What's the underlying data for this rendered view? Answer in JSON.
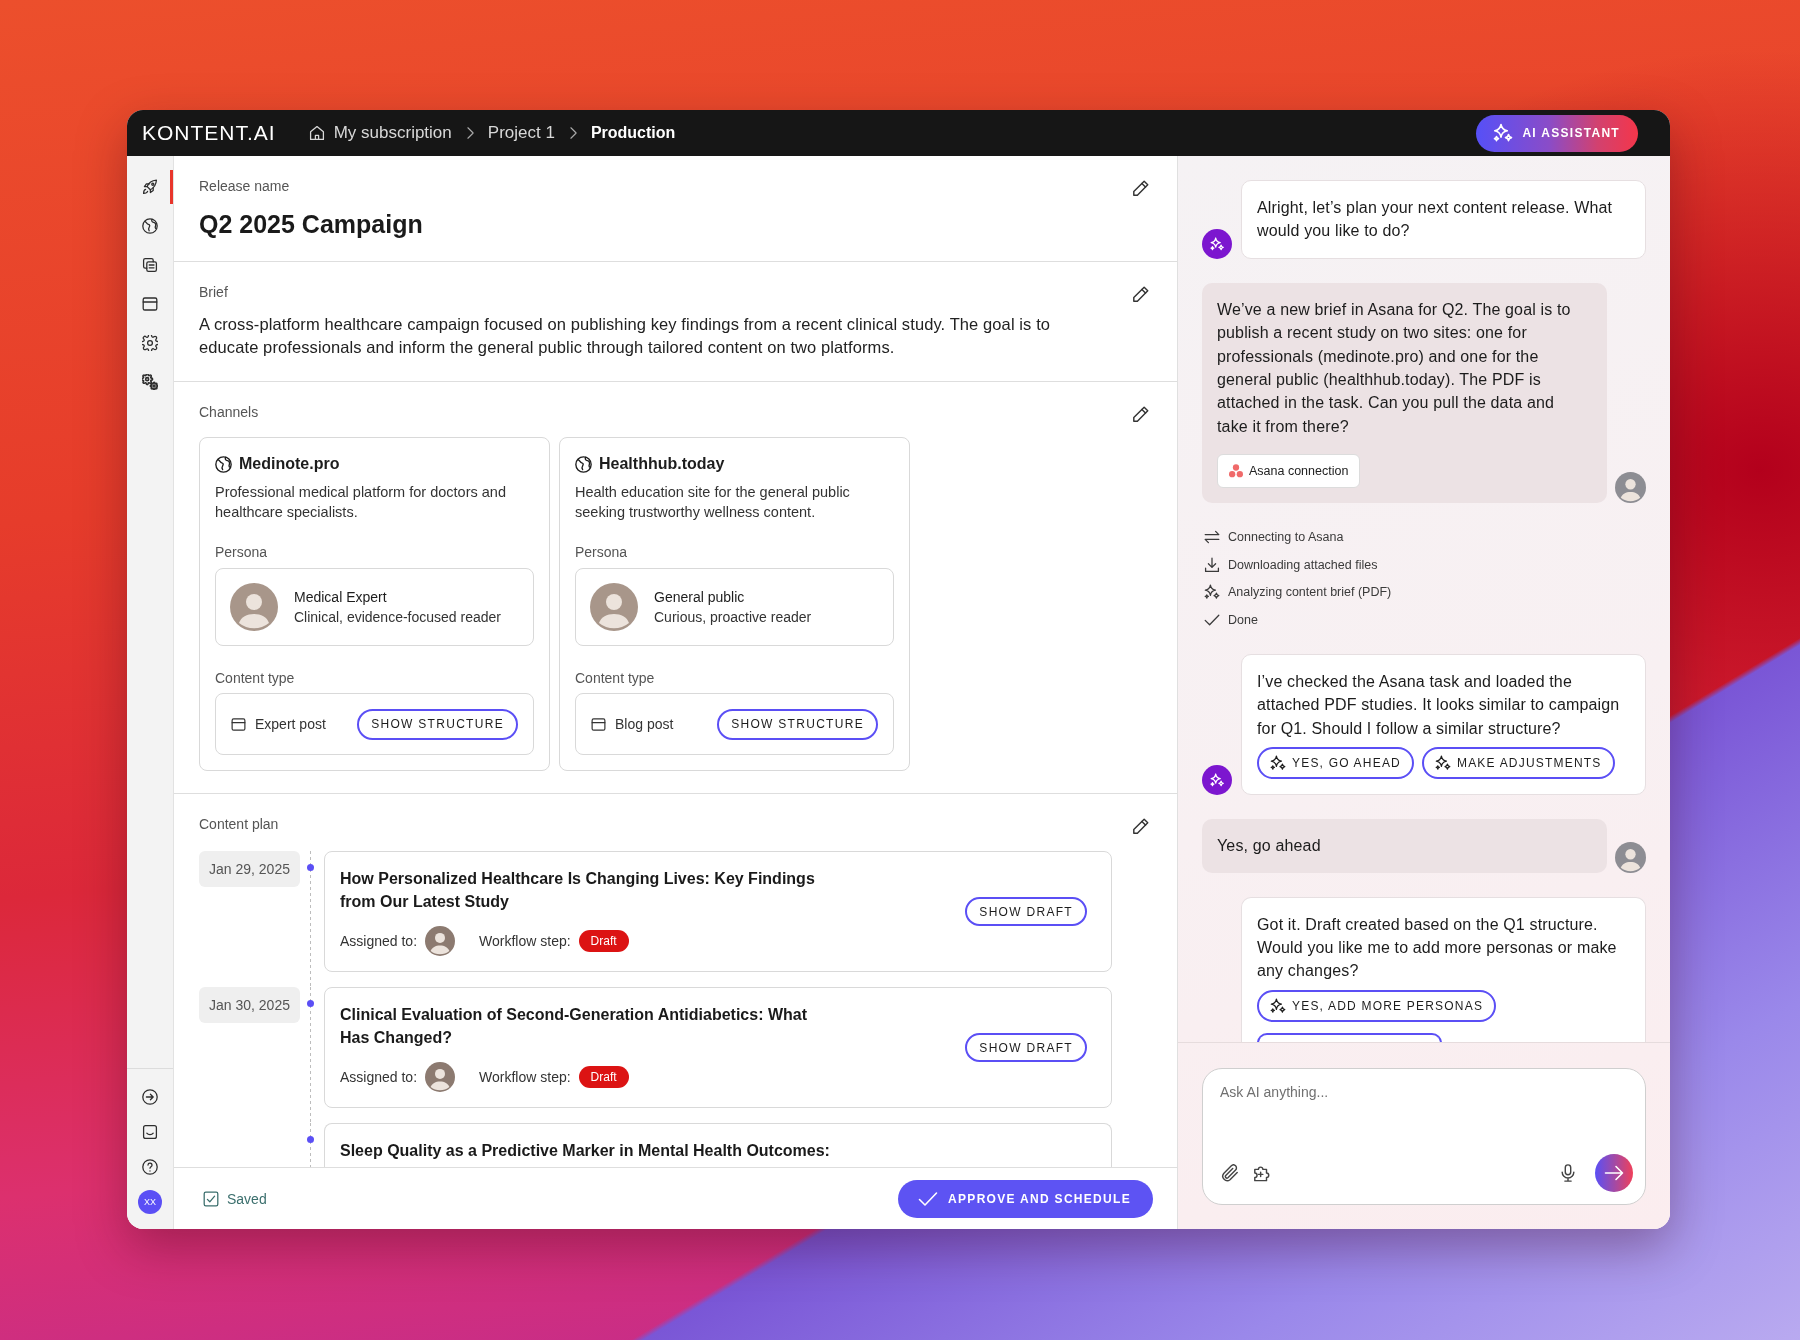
{
  "header": {
    "logo": "KONTENT.AI",
    "breadcrumbs": [
      {
        "label": "My subscription",
        "current": false
      },
      {
        "label": "Project 1",
        "current": false
      },
      {
        "label": "Production",
        "current": true
      }
    ],
    "assistant_button": "AI ASSISTANT"
  },
  "sidebar": {
    "items": [
      {
        "selected": true
      },
      {
        "selected": false
      },
      {
        "selected": false
      },
      {
        "selected": false
      },
      {
        "selected": false
      },
      {
        "selected": false
      }
    ],
    "bottom_items": [
      {
        "selected": false
      },
      {
        "selected": false
      },
      {
        "selected": false
      }
    ],
    "user_initials": "XX"
  },
  "release": {
    "label": "Release name",
    "title": "Q2 2025 Campaign"
  },
  "brief": {
    "label": "Brief",
    "text": "A cross-platform healthcare campaign focused on publishing key findings from a recent clinical study. The goal is to educate professionals and inform the general public through tailored content on two platforms."
  },
  "channels": {
    "label": "Channels",
    "items": [
      {
        "name": "Medinote.pro",
        "description": "Professional medical platform for doctors and healthcare specialists.",
        "persona_label": "Persona",
        "persona": {
          "name": "Medical Expert",
          "role": "Clinical, evidence-focused reader"
        },
        "content_type_label": "Content type",
        "content_type": "Expert post",
        "button": "SHOW STRUCTURE"
      },
      {
        "name": "Healthhub.today",
        "description": "Health education site for the general public seeking trustworthy wellness content.",
        "persona_label": "Persona",
        "persona": {
          "name": "General public",
          "role": "Curious, proactive reader"
        },
        "content_type_label": "Content type",
        "content_type": "Blog post",
        "button": "SHOW STRUCTURE"
      }
    ]
  },
  "content_plan": {
    "label": "Content plan",
    "items": [
      {
        "date": "Jan 29, 2025",
        "title": "How Personalized Healthcare Is Changing Lives: Key Findings from Our Latest Study",
        "assigned_label": "Assigned to:",
        "workflow_label": "Workflow step:",
        "status": "Draft",
        "button": "SHOW DRAFT"
      },
      {
        "date": "Jan 30, 2025",
        "title": "Clinical Evaluation of Second-Generation Antidiabetics: What Has Changed?",
        "assigned_label": "Assigned to:",
        "workflow_label": "Workflow step:",
        "status": "Draft",
        "button": "SHOW DRAFT"
      },
      {
        "title": "Sleep Quality as a Predictive Marker in Mental Health Outcomes:"
      }
    ]
  },
  "footer": {
    "saved": "Saved",
    "approve_button": "APPROVE AND SCHEDULE"
  },
  "assistant": {
    "messages": [
      {
        "kind": "ai",
        "text": "Alright, let’s plan your next content release. What would you like to do?"
      },
      {
        "kind": "user",
        "text": "We’ve a new brief in Asana for Q2. The goal is to publish a recent study on two sites: one for professionals (medinote.pro) and one for the general public (healthhub.today). The PDF is attached in the task. Can you pull the data and take it from there?",
        "attachment": "Asana connection"
      },
      {
        "kind": "steps",
        "steps": [
          "Connecting to Asana",
          "Downloading attached files",
          "Analyzing content brief (PDF)",
          "Done"
        ]
      },
      {
        "kind": "ai",
        "text": "I’ve checked the Asana task and loaded the attached PDF studies. It looks similar to campaign for Q1. Should I follow a similar structure?",
        "suggestions": [
          {
            "kind": "button",
            "label": "YES, GO AHEAD"
          },
          {
            "kind": "button",
            "label": "MAKE ADJUSTMENTS"
          }
        ]
      },
      {
        "kind": "user",
        "text": "Yes, go ahead"
      },
      {
        "kind": "ai",
        "text": "Got it. Draft created based on the Q1 structure. Would you like me to add more personas or make any changes?",
        "suggestions": [
          {
            "kind": "button",
            "label": "YES, ADD MORE PERSONAS"
          },
          {
            "kind": "cut"
          }
        ]
      }
    ],
    "composer": {
      "placeholder": "Ask AI anything..."
    }
  }
}
